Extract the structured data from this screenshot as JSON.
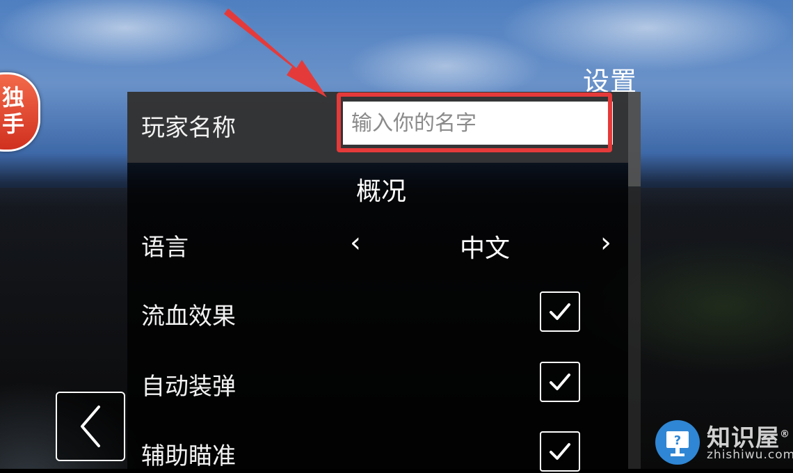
{
  "settings_title": "设置",
  "player_name": {
    "label": "玩家名称",
    "placeholder": "输入你的名字",
    "value": ""
  },
  "section_overview": "概况",
  "language": {
    "label": "语言",
    "prev": "‹",
    "value": "中文",
    "next": "›"
  },
  "options": [
    {
      "label": "流血效果",
      "checked": true
    },
    {
      "label": "自动装弹",
      "checked": true
    },
    {
      "label": "辅助瞄准",
      "checked": true
    }
  ],
  "side_badge": {
    "text": "独手"
  },
  "watermark": {
    "name": "知识屋",
    "reg": "®",
    "url": "zhishiwu.com"
  },
  "colors": {
    "highlight": "#e53a3a",
    "watermark_blue": "#2f86d4"
  },
  "icons": {
    "back": "chevron-left-icon",
    "check": "checkmark-icon",
    "arrow": "red-arrow-icon"
  }
}
